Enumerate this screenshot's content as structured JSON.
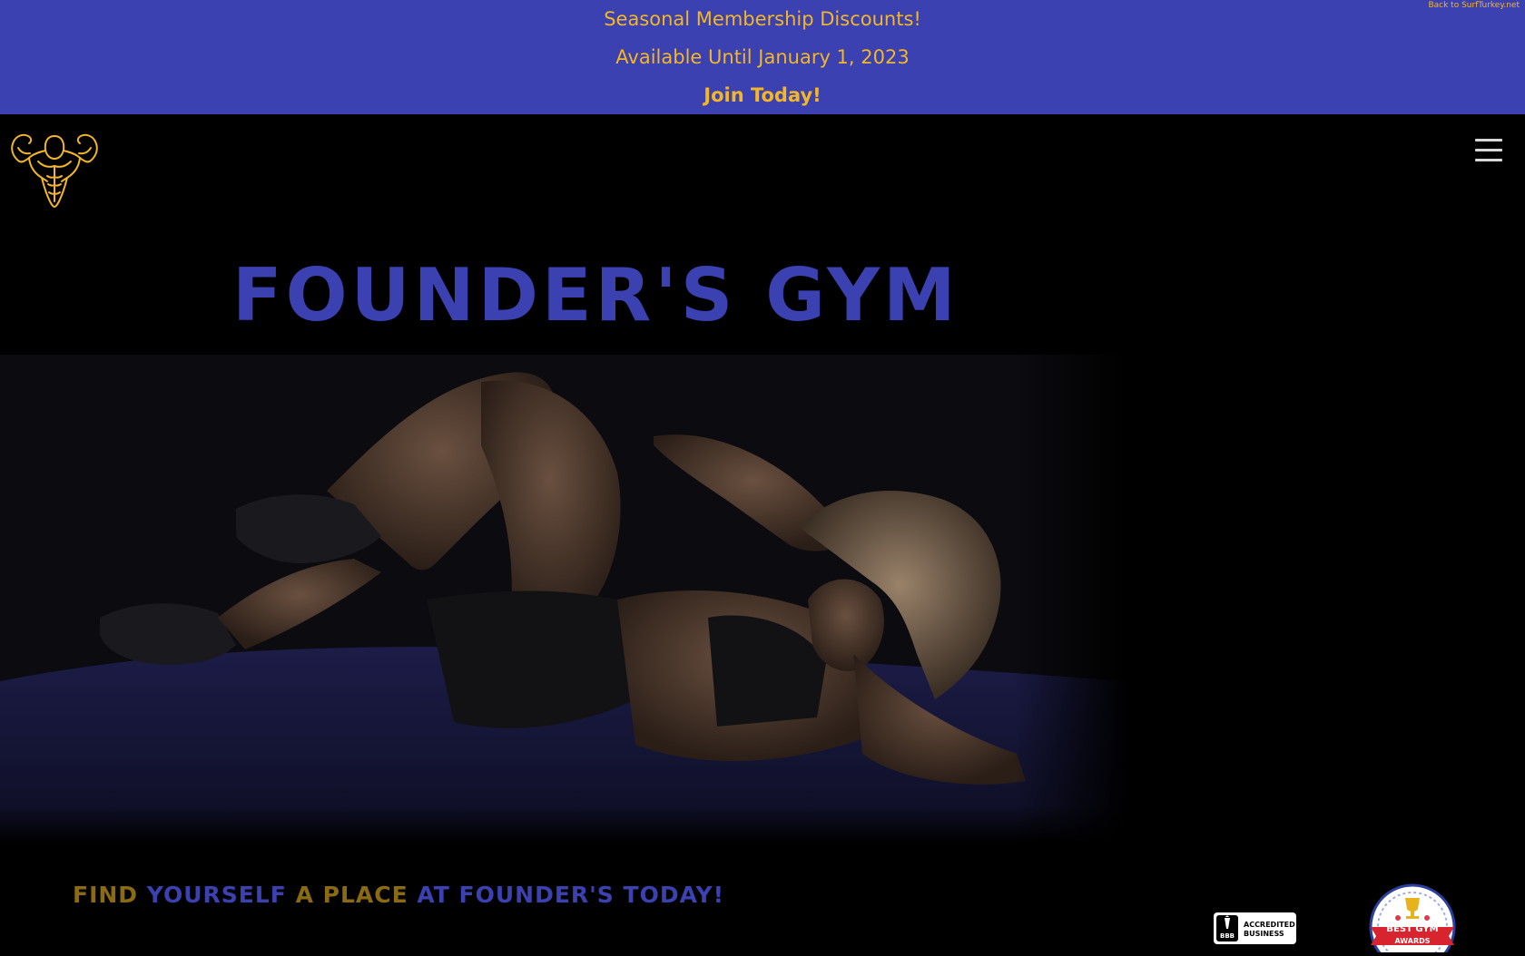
{
  "promo": {
    "line1": "Seasonal Membership Discounts!",
    "line2": "Available Until January 1, 2023",
    "join_label": "Join Today!"
  },
  "back_link": "Back to SurfTurkey.net",
  "header": {
    "logo_icon": "flexing-bodybuilder-icon",
    "menu_icon": "hamburger-menu-icon"
  },
  "hero": {
    "title": "FOUNDER'S GYM",
    "image_alt": "Woman doing crunches on a mat in a dark gym"
  },
  "tagline": {
    "part1": "FIND ",
    "part2": "YOURSELF ",
    "part3": "A PLACE ",
    "part4": "AT FOUNDER'S TODAY!"
  },
  "badges": {
    "bbb_mark": "BBB",
    "bbb_line1": "ACCREDITED",
    "bbb_line2": "BUSINESS",
    "award_line1": "BEST GYM",
    "award_line2": "AWARDS"
  },
  "colors": {
    "brand_blue": "#3b41b1",
    "brand_gold": "#f2b626",
    "background": "#000000"
  }
}
